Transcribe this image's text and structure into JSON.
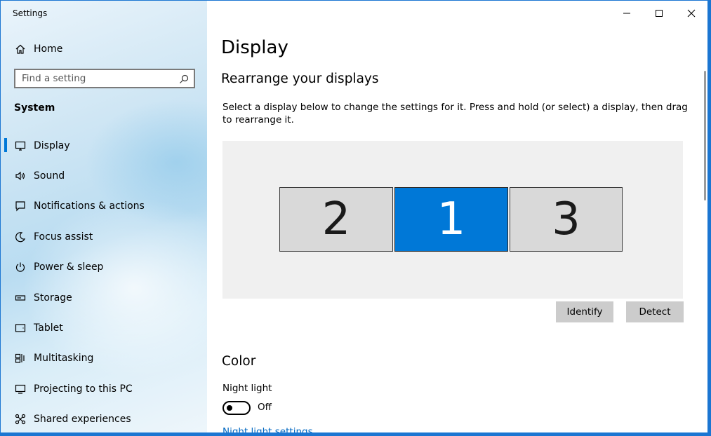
{
  "window": {
    "title": "Settings"
  },
  "sidebar": {
    "home_label": "Home",
    "search_placeholder": "Find a setting",
    "section_label": "System",
    "items": [
      {
        "label": "Display",
        "icon": "display-icon",
        "active": true
      },
      {
        "label": "Sound",
        "icon": "sound-icon"
      },
      {
        "label": "Notifications & actions",
        "icon": "notifications-icon"
      },
      {
        "label": "Focus assist",
        "icon": "focus-assist-icon"
      },
      {
        "label": "Power & sleep",
        "icon": "power-icon"
      },
      {
        "label": "Storage",
        "icon": "storage-icon"
      },
      {
        "label": "Tablet",
        "icon": "tablet-icon"
      },
      {
        "label": "Multitasking",
        "icon": "multitasking-icon"
      },
      {
        "label": "Projecting to this PC",
        "icon": "projecting-icon"
      },
      {
        "label": "Shared experiences",
        "icon": "shared-experiences-icon"
      }
    ]
  },
  "main": {
    "page_title": "Display",
    "rearrange_heading": "Rearrange your displays",
    "rearrange_desc": "Select a display below to change the settings for it. Press and hold (or select) a display, then drag to rearrange it.",
    "monitors": [
      {
        "number": "2",
        "selected": false
      },
      {
        "number": "1",
        "selected": true
      },
      {
        "number": "3",
        "selected": false
      }
    ],
    "identify_label": "Identify",
    "detect_label": "Detect",
    "color_heading": "Color",
    "night_light_label": "Night light",
    "night_light_state": "Off",
    "night_light_settings_link": "Night light settings"
  },
  "colors": {
    "accent": "#0078d7",
    "window_border": "#1b76d2",
    "button_bg": "#cccccc",
    "arrange_bg": "#f0f0f0",
    "link": "#0067c0"
  }
}
